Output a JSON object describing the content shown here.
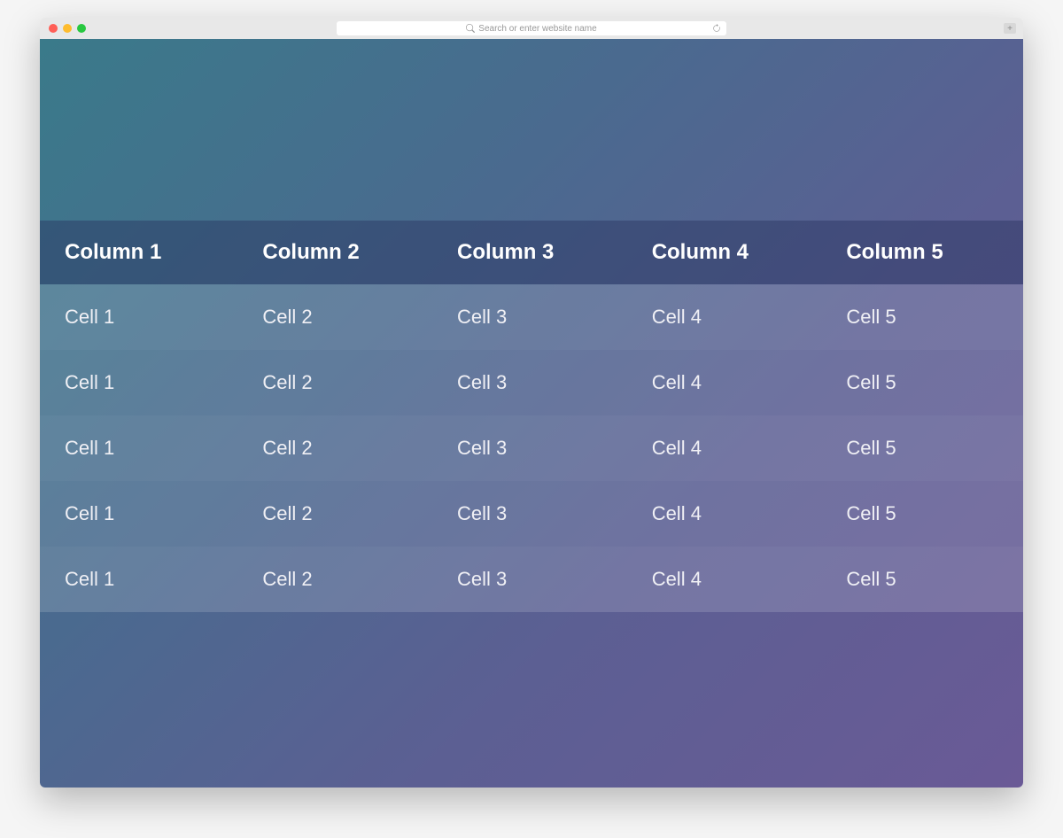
{
  "browser": {
    "address_placeholder": "Search or enter website name"
  },
  "table": {
    "headers": [
      "Column 1",
      "Column 2",
      "Column 3",
      "Column 4",
      "Column 5"
    ],
    "rows": [
      [
        "Cell 1",
        "Cell 2",
        "Cell 3",
        "Cell 4",
        "Cell 5"
      ],
      [
        "Cell 1",
        "Cell 2",
        "Cell 3",
        "Cell 4",
        "Cell 5"
      ],
      [
        "Cell 1",
        "Cell 2",
        "Cell 3",
        "Cell 4",
        "Cell 5"
      ],
      [
        "Cell 1",
        "Cell 2",
        "Cell 3",
        "Cell 4",
        "Cell 5"
      ],
      [
        "Cell 1",
        "Cell 2",
        "Cell 3",
        "Cell 4",
        "Cell 5"
      ]
    ]
  }
}
